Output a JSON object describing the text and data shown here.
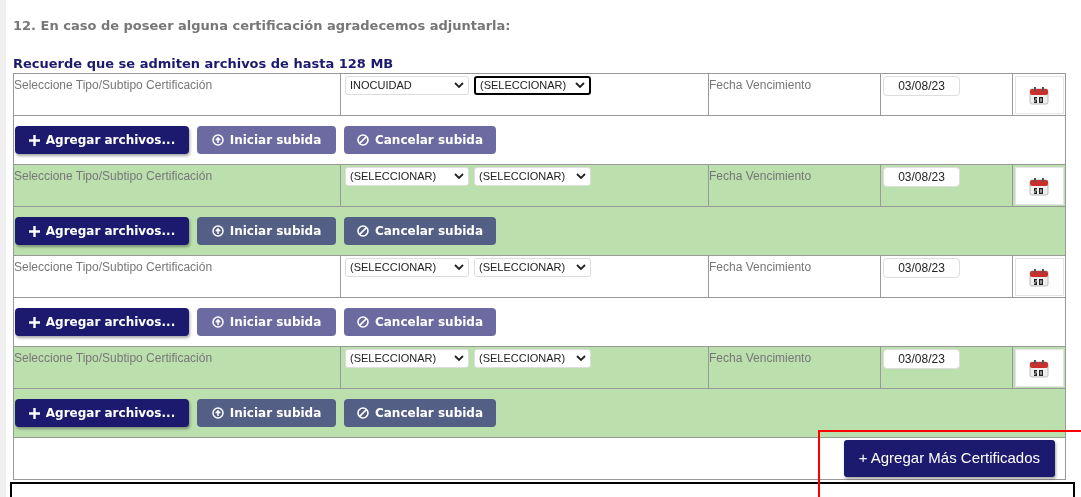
{
  "question": "12. En caso de poseer alguna certificación agradecemos adjuntarla:",
  "notice": "Recuerde que se admiten archivos de hasta 128 MB",
  "certificates": [
    {
      "highlighted": false,
      "label": "Seleccione Tipo/Subtipo Certificación",
      "type": {
        "value": "INOCUIDAD",
        "focused": false
      },
      "subtype": {
        "value": "(SELECCIONAR)",
        "focused": true
      },
      "date_label": "Fecha Vencimiento",
      "date": "03/08/23",
      "buttons": [
        {
          "kind": "add",
          "label": "Agregar archivos..."
        },
        {
          "kind": "start",
          "label": "Iniciar subida"
        },
        {
          "kind": "cancel",
          "label": "Cancelar subida"
        }
      ]
    },
    {
      "highlighted": true,
      "label": "Seleccione Tipo/Subtipo Certificación",
      "type": {
        "value": "(SELECCIONAR)",
        "focused": false
      },
      "subtype": {
        "value": "(SELECCIONAR)",
        "focused": false
      },
      "date_label": "Fecha Vencimiento",
      "date": "03/08/23",
      "buttons": [
        {
          "kind": "add",
          "label": "Agregar archivos..."
        },
        {
          "kind": "start",
          "label": "Iniciar subida"
        },
        {
          "kind": "cancel",
          "label": "Cancelar subida"
        }
      ]
    },
    {
      "highlighted": false,
      "label": "Seleccione Tipo/Subtipo Certificación",
      "type": {
        "value": "(SELECCIONAR)",
        "focused": false
      },
      "subtype": {
        "value": "(SELECCIONAR)",
        "focused": false
      },
      "date_label": "Fecha Vencimiento",
      "date": "03/08/23",
      "buttons": [
        {
          "kind": "add",
          "label": "Agregar archivos..."
        },
        {
          "kind": "start",
          "label": "Iniciar subida"
        },
        {
          "kind": "cancel",
          "label": "Cancelar subida"
        }
      ]
    },
    {
      "highlighted": true,
      "label": "Seleccione Tipo/Subtipo Certificación",
      "type": {
        "value": "(SELECCIONAR)",
        "focused": false
      },
      "subtype": {
        "value": "(SELECCIONAR)",
        "focused": false
      },
      "date_label": "Fecha Vencimiento",
      "date": "03/08/23",
      "buttons": [
        {
          "kind": "add",
          "label": "Agregar archivos..."
        },
        {
          "kind": "start",
          "label": "Iniciar subida"
        },
        {
          "kind": "cancel",
          "label": "Cancelar subida"
        }
      ]
    }
  ],
  "add_more_button": {
    "label": "+ Agregar Más Certificados",
    "highlighted": true
  }
}
